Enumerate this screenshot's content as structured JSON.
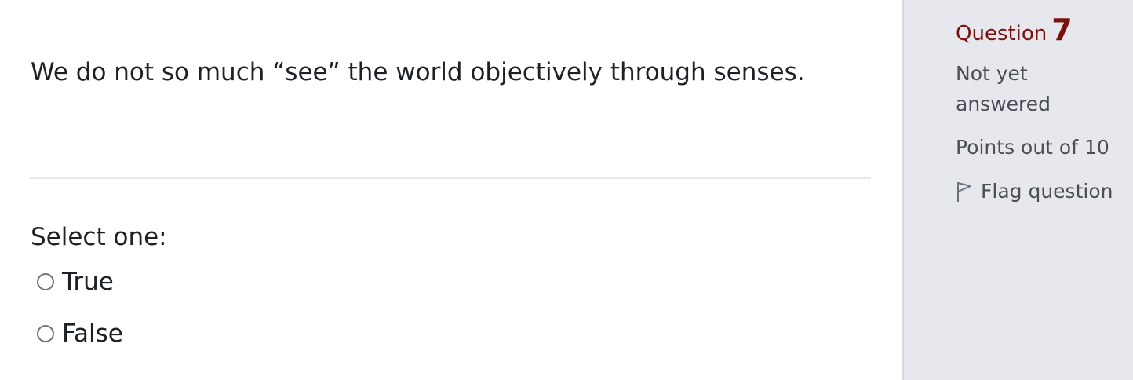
{
  "question": {
    "text": "We do not so much “see” the world objectively through senses.",
    "prompt": "Select one:",
    "options": [
      {
        "label": "True",
        "selected": false
      },
      {
        "label": "False",
        "selected": false
      }
    ]
  },
  "info": {
    "question_label": "Question",
    "question_number": "7",
    "state": "Not yet answered",
    "grade": "Points out of 10",
    "flag_label": "Flag question",
    "flag_icon": "flag-outline-icon"
  },
  "colors": {
    "accent": "#7a1212",
    "sidebar_bg": "#e7e8ed",
    "text": "#1d2125",
    "muted_text": "#4a4f55"
  }
}
